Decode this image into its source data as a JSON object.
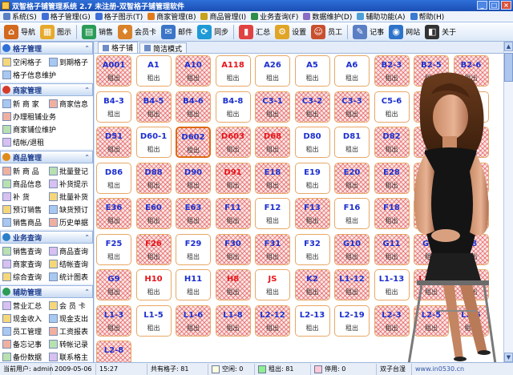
{
  "window": {
    "title": "双智格子铺管理系统 2.7    未注册-双智格子铺管理软件",
    "min": "_",
    "max": "□",
    "close": "×"
  },
  "menu": [
    {
      "label": "系统(S)",
      "color": "#5a7fc4"
    },
    {
      "label": "格子管理(G)",
      "color": "#3f6fd6"
    },
    {
      "label": "格子图示(T)",
      "color": "#3f6fd6"
    },
    {
      "label": "商家管理(B)",
      "color": "#e07a1c"
    },
    {
      "label": "商品管理(I)",
      "color": "#c9a11b"
    },
    {
      "label": "业务查询(F)",
      "color": "#2f8d4a"
    },
    {
      "label": "数据维护(D)",
      "color": "#8a6bc5"
    },
    {
      "label": "辅助功能(A)",
      "color": "#4d9fd6"
    },
    {
      "label": "帮助(H)",
      "color": "#3b7ad1"
    }
  ],
  "toolbar": [
    {
      "label": "导航",
      "glyph": "⌂",
      "color": "#d2691e"
    },
    {
      "label": "图示",
      "glyph": "▦",
      "color": "#e6a92b"
    },
    {
      "label": "销售",
      "glyph": "▤",
      "color": "#2b9c57"
    },
    {
      "label": "会员卡",
      "glyph": "♦",
      "color": "#d9822b"
    },
    {
      "label": "邮件",
      "glyph": "✉",
      "color": "#3a75c8"
    },
    {
      "label": "同步",
      "glyph": "⟳",
      "color": "#1e9ad6"
    },
    {
      "label": "汇总",
      "glyph": "▮",
      "color": "#e04242"
    },
    {
      "label": "设置",
      "glyph": "⚙",
      "color": "#e1a526"
    },
    {
      "label": "员工",
      "glyph": "☺",
      "color": "#c8502f"
    },
    {
      "label": "记事",
      "glyph": "✎",
      "color": "#5a7fc4"
    },
    {
      "label": "网站",
      "glyph": "◉",
      "color": "#2d73c9"
    },
    {
      "label": "关于",
      "glyph": "◧",
      "color": "#333333"
    }
  ],
  "sidebar": [
    {
      "title": "格子管理",
      "color": "#2f6fd8",
      "rows": [
        [
          "空闲格子",
          "到期格子"
        ],
        [
          "格子信息维护"
        ]
      ]
    },
    {
      "title": "商家管理",
      "color": "#d63b2a",
      "rows": [
        [
          "新 商 家",
          "商家信息"
        ],
        [
          "办理租铺业务"
        ],
        [
          "商家铺位维护"
        ],
        [
          "结帐/退租"
        ]
      ]
    },
    {
      "title": "商品管理",
      "color": "#e08c1a",
      "rows": [
        [
          "新 商 品",
          "批量登记"
        ],
        [
          "商品信息",
          "补货提示"
        ],
        [
          "补    货",
          "批量补货"
        ],
        [
          "预订销售",
          "缺货预订"
        ],
        [
          "销售商品",
          "历史单据"
        ]
      ]
    },
    {
      "title": "业务查询",
      "color": "#2b7fc9",
      "rows": [
        [
          "销售查询",
          "商品查询"
        ],
        [
          "商家查询",
          "结帐查询"
        ],
        [
          "综合查询",
          "统计图表"
        ]
      ]
    },
    {
      "title": "辅助管理",
      "color": "#2b9c57",
      "rows": [
        [
          "营业汇总",
          "会 员 卡"
        ],
        [
          "现金收入",
          "现金支出"
        ],
        [
          "员工管理",
          "工资报表"
        ],
        [
          "备忘记事",
          "转帐记录"
        ],
        [
          "备份数据",
          "联系格主"
        ]
      ]
    }
  ],
  "tabs": [
    "格子铺",
    "简洁模式"
  ],
  "cells": [
    {
      "code": "A001",
      "status": "租出",
      "rent": true,
      "red": false
    },
    {
      "code": "A1",
      "status": "租出",
      "rent": false,
      "red": false
    },
    {
      "code": "A10",
      "status": "租出",
      "rent": true,
      "red": false
    },
    {
      "code": "A118",
      "status": "租出",
      "rent": false,
      "red": true
    },
    {
      "code": "A26",
      "status": "租出",
      "rent": false,
      "red": false
    },
    {
      "code": "A5",
      "status": "租出",
      "rent": false,
      "red": false
    },
    {
      "code": "A6",
      "status": "租出",
      "rent": false,
      "red": false
    },
    {
      "code": "B2-3",
      "status": "租出",
      "rent": true,
      "red": false
    },
    {
      "code": "B2-5",
      "status": "租出",
      "rent": true,
      "red": false
    },
    {
      "code": "B2-6",
      "status": "租出",
      "rent": true,
      "red": false
    },
    {
      "code": "B4-3",
      "status": "租出",
      "rent": false,
      "red": false
    },
    {
      "code": "B4-5",
      "status": "租出",
      "rent": true,
      "red": false
    },
    {
      "code": "B4-6",
      "status": "租出",
      "rent": true,
      "red": false
    },
    {
      "code": "B4-8",
      "status": "租出",
      "rent": false,
      "red": false
    },
    {
      "code": "C3-1",
      "status": "租出",
      "rent": true,
      "red": false
    },
    {
      "code": "C3-2",
      "status": "租出",
      "rent": true,
      "red": false
    },
    {
      "code": "C3-3",
      "status": "租出",
      "rent": true,
      "red": false
    },
    {
      "code": "C5-6",
      "status": "租出",
      "rent": false,
      "red": false
    },
    {
      "code": "D106",
      "status": "租出",
      "rent": true,
      "red": false
    },
    {
      "code": "D12",
      "status": "租出",
      "rent": false,
      "red": false
    },
    {
      "code": "D51",
      "status": "租出",
      "rent": true,
      "red": false
    },
    {
      "code": "D60-1",
      "status": "租出",
      "rent": false,
      "red": false
    },
    {
      "code": "D602",
      "status": "租出",
      "rent": true,
      "red": false,
      "sel": true
    },
    {
      "code": "D603",
      "status": "租出",
      "rent": true,
      "red": true
    },
    {
      "code": "D68",
      "status": "租出",
      "rent": true,
      "red": true
    },
    {
      "code": "D80",
      "status": "租出",
      "rent": false,
      "red": false
    },
    {
      "code": "D81",
      "status": "租出",
      "rent": false,
      "red": false
    },
    {
      "code": "D82",
      "status": "租出",
      "rent": true,
      "red": false
    },
    {
      "code": "D83",
      "status": "租出",
      "rent": true,
      "red": false
    },
    {
      "code": "D85",
      "status": "租出",
      "rent": true,
      "red": false
    },
    {
      "code": "D86",
      "status": "租出",
      "rent": false,
      "red": false
    },
    {
      "code": "D88",
      "status": "租出",
      "rent": true,
      "red": false
    },
    {
      "code": "D90",
      "status": "租出",
      "rent": true,
      "red": false
    },
    {
      "code": "D91",
      "status": "租出",
      "rent": true,
      "red": true
    },
    {
      "code": "E18",
      "status": "租出",
      "rent": true,
      "red": false
    },
    {
      "code": "E19",
      "status": "租出",
      "rent": false,
      "red": false
    },
    {
      "code": "E20",
      "status": "租出",
      "rent": true,
      "red": false
    },
    {
      "code": "E28",
      "status": "租出",
      "rent": true,
      "red": false
    },
    {
      "code": "E30",
      "status": "租出",
      "rent": true,
      "red": false
    },
    {
      "code": "E31",
      "status": "租出",
      "rent": true,
      "red": false
    },
    {
      "code": "E36",
      "status": "租出",
      "rent": true,
      "red": false
    },
    {
      "code": "E60",
      "status": "租出",
      "rent": true,
      "red": false
    },
    {
      "code": "E63",
      "status": "租出",
      "rent": true,
      "red": false
    },
    {
      "code": "F11",
      "status": "租出",
      "rent": true,
      "red": false
    },
    {
      "code": "F12",
      "status": "租出",
      "rent": false,
      "red": false
    },
    {
      "code": "F13",
      "status": "租出",
      "rent": true,
      "red": false
    },
    {
      "code": "F16",
      "status": "租出",
      "rent": false,
      "red": false
    },
    {
      "code": "F18",
      "status": "租出",
      "rent": true,
      "red": false
    },
    {
      "code": "F19",
      "status": "租出",
      "rent": true,
      "red": false
    },
    {
      "code": "F23",
      "status": "租出",
      "rent": true,
      "red": false
    },
    {
      "code": "F25",
      "status": "租出",
      "rent": false,
      "red": false
    },
    {
      "code": "F26",
      "status": "租出",
      "rent": true,
      "red": true
    },
    {
      "code": "F29",
      "status": "租出",
      "rent": false,
      "red": false
    },
    {
      "code": "F30",
      "status": "租出",
      "rent": true,
      "red": false
    },
    {
      "code": "F31",
      "status": "租出",
      "rent": true,
      "red": false
    },
    {
      "code": "F32",
      "status": "租出",
      "rent": false,
      "red": false
    },
    {
      "code": "G10",
      "status": "租出",
      "rent": true,
      "red": false
    },
    {
      "code": "G11",
      "status": "租出",
      "rent": true,
      "red": false
    },
    {
      "code": "G12",
      "status": "租出",
      "rent": true,
      "red": false
    },
    {
      "code": "G8",
      "status": "租出",
      "rent": true,
      "red": false
    },
    {
      "code": "G9",
      "status": "租出",
      "rent": true,
      "red": false
    },
    {
      "code": "H10",
      "status": "租出",
      "rent": false,
      "red": true
    },
    {
      "code": "H11",
      "status": "租出",
      "rent": false,
      "red": false
    },
    {
      "code": "H8",
      "status": "租出",
      "rent": true,
      "red": true
    },
    {
      "code": "JS",
      "status": "租出",
      "rent": false,
      "red": true
    },
    {
      "code": "K2",
      "status": "租出",
      "rent": true,
      "red": false
    },
    {
      "code": "L1-12",
      "status": "租出",
      "rent": true,
      "red": false
    },
    {
      "code": "L1-13",
      "status": "租出",
      "rent": false,
      "red": false
    },
    {
      "code": "L1-19",
      "status": "租出",
      "rent": true,
      "red": true
    },
    {
      "code": "L1-2",
      "status": "租出",
      "rent": true,
      "red": true
    },
    {
      "code": "L1-3",
      "status": "租出",
      "rent": true,
      "red": false
    },
    {
      "code": "L1-5",
      "status": "租出",
      "rent": false,
      "red": false
    },
    {
      "code": "L1-6",
      "status": "租出",
      "rent": true,
      "red": false
    },
    {
      "code": "L1-8",
      "status": "租出",
      "rent": true,
      "red": false
    },
    {
      "code": "L2-12",
      "status": "租出",
      "rent": true,
      "red": false
    },
    {
      "code": "L2-13",
      "status": "租出",
      "rent": false,
      "red": false
    },
    {
      "code": "L2-19",
      "status": "租出",
      "rent": false,
      "red": false
    },
    {
      "code": "L2-3",
      "status": "租出",
      "rent": true,
      "red": false
    },
    {
      "code": "L2-5",
      "status": "租出",
      "rent": true,
      "red": false
    },
    {
      "code": "L2-6",
      "status": "租出",
      "rent": true,
      "red": false
    },
    {
      "code": "L2-8",
      "status": "",
      "rent": true,
      "red": false
    }
  ],
  "status": {
    "user": "当前用户: admin",
    "date": "2009-05-06",
    "time": "15:27",
    "total": "共有格子: 81",
    "free": "空闲: 0",
    "rented": "租出: 81",
    "stopped": "停用: 0",
    "site": "双子台湿",
    "url": "www.in0530.cn",
    "free_color": "#ffffe0",
    "rented_color": "#90ee90",
    "stopped_color": "#ffc8d8"
  }
}
